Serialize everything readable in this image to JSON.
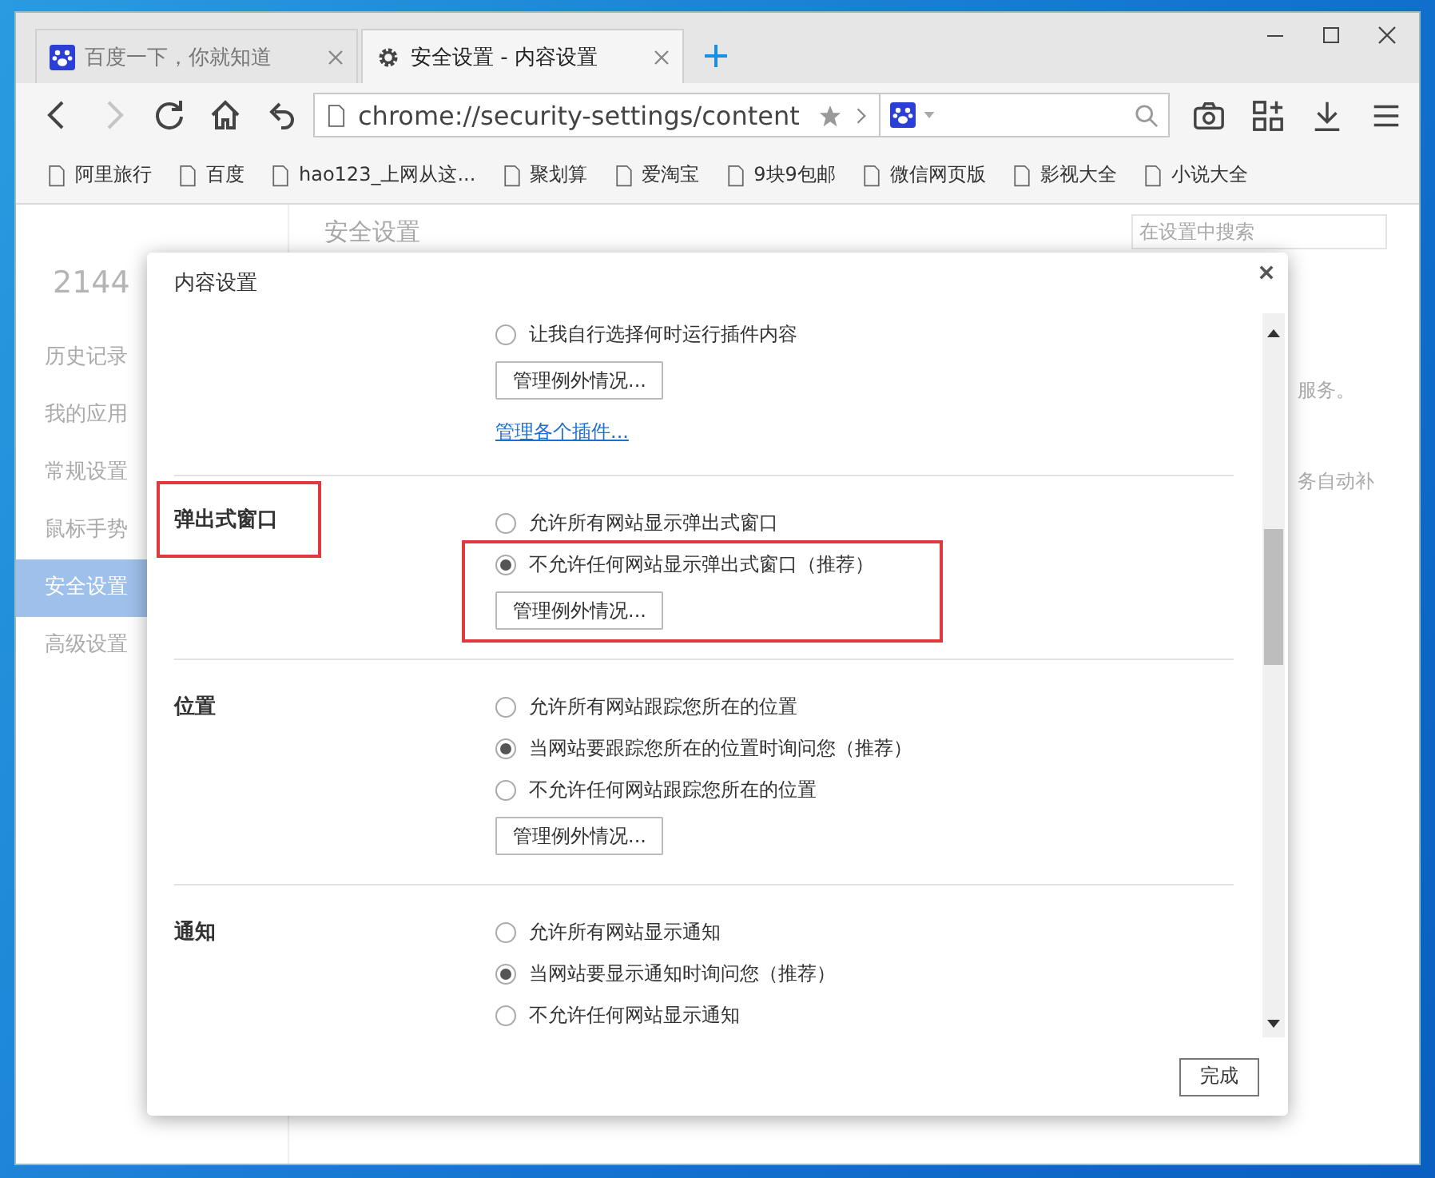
{
  "tabs": [
    {
      "title": "百度一下，你就知道",
      "selected": false
    },
    {
      "title": "安全设置 - 内容设置",
      "selected": true
    }
  ],
  "nav_buttons": [
    {
      "kind": "back",
      "disabled": false
    },
    {
      "kind": "forward",
      "disabled": true
    },
    {
      "kind": "reload",
      "disabled": false
    },
    {
      "kind": "home",
      "disabled": false
    },
    {
      "kind": "undo",
      "disabled": false
    }
  ],
  "address": "chrome://security-settings/content",
  "bookmarks": [
    "阿里旅行",
    "百度",
    "hao123_上网从这...",
    "聚划算",
    "爱淘宝",
    "9块9包邮",
    "微信网页版",
    "影视大全",
    "小说大全"
  ],
  "settings_page": {
    "logo": "2144",
    "sidebar": [
      {
        "label": "历史记录",
        "selected": false
      },
      {
        "label": "我的应用",
        "selected": false
      },
      {
        "label": "常规设置",
        "selected": false
      },
      {
        "label": "鼠标手势",
        "selected": false
      },
      {
        "label": "安全设置",
        "selected": true
      },
      {
        "label": "高级设置",
        "selected": false
      }
    ],
    "heading": "安全设置",
    "search": {
      "placeholder": "在设置中搜索"
    },
    "fragments": [
      "服务。",
      "务自动补"
    ]
  },
  "dialog": {
    "title": "内容设置",
    "sections": [
      {
        "selection_highlighted": false,
        "options": [
          {
            "label": "让我自行选择何时运行插件内容",
            "selected": false
          }
        ],
        "button": "管理例外情况...",
        "link": "管理各个插件..."
      },
      {
        "title": "弹出式窗口",
        "title_highlighted": true,
        "selection_highlighted": true,
        "options": [
          {
            "label": "允许所有网站显示弹出式窗口",
            "selected": false
          },
          {
            "label": "不允许任何网站显示弹出式窗口（推荐）",
            "selected": true
          }
        ],
        "button": "管理例外情况..."
      },
      {
        "title": "位置",
        "title_highlighted": false,
        "selection_highlighted": false,
        "options": [
          {
            "label": "允许所有网站跟踪您所在的位置",
            "selected": false
          },
          {
            "label": "当网站要跟踪您所在的位置时询问您（推荐）",
            "selected": true
          },
          {
            "label": "不允许任何网站跟踪您所在的位置",
            "selected": false
          }
        ],
        "button": "管理例外情况..."
      },
      {
        "title": "通知",
        "title_highlighted": false,
        "selection_highlighted": false,
        "options": [
          {
            "label": "允许所有网站显示通知",
            "selected": false
          },
          {
            "label": "当网站要显示通知时询问您（推荐）",
            "selected": true
          },
          {
            "label": "不允许任何网站显示通知",
            "selected": false
          }
        ]
      }
    ],
    "done": "完成"
  }
}
